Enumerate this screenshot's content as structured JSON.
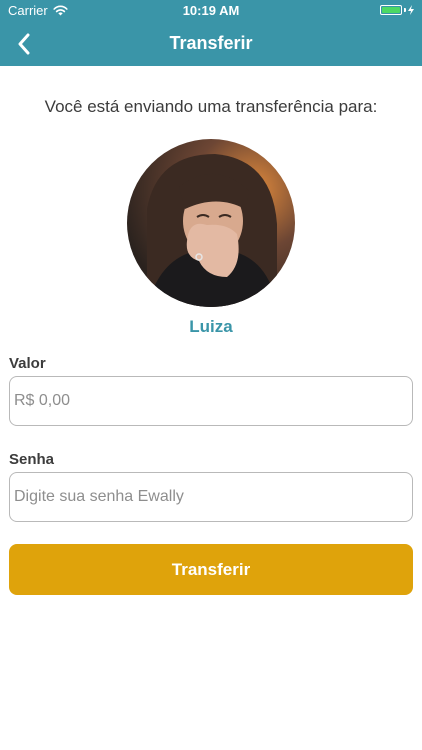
{
  "status_bar": {
    "carrier": "Carrier",
    "time": "10:19 AM"
  },
  "nav": {
    "title": "Transferir",
    "back_icon": "chevron-left-icon"
  },
  "intro_text": "Você está enviando uma transferência para:",
  "recipient": {
    "name": "Luiza"
  },
  "form": {
    "amount_label": "Valor",
    "amount_placeholder": "R$ 0,00",
    "password_label": "Senha",
    "password_placeholder": "Digite sua senha Ewally"
  },
  "transfer_button": {
    "label": "Transferir"
  },
  "colors": {
    "primary": "#3a95a8",
    "button": "#dfa30b",
    "text": "#3c3c3c",
    "field_border": "#b9b9b9",
    "battery": "#4cd964"
  }
}
